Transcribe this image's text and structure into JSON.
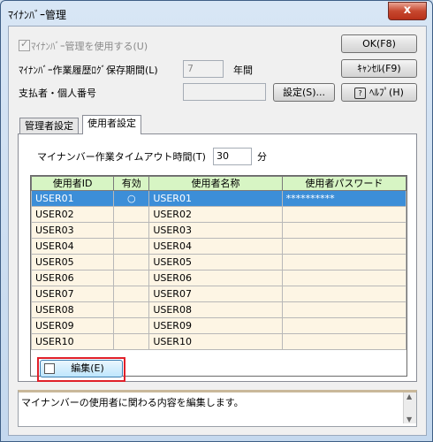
{
  "window": {
    "title": "ﾏｲﾅﾝﾊﾞｰ管理",
    "close": "x"
  },
  "settings": {
    "use_label": "ﾏｲﾅﾝﾊﾞｰ管理を使用する(U)",
    "use_checked": true,
    "retention_label": "ﾏｲﾅﾝﾊﾞｰ作業履歴ﾛｸﾞ保存期間(L)",
    "retention_value": "7",
    "retention_unit": "年間",
    "payer_label": "支払者・個人番号",
    "payer_value": ""
  },
  "buttons": {
    "ok": "OK(F8)",
    "cancel": "ｷｬﾝｾﾙ(F9)",
    "settings": "設定(S)...",
    "help": "ﾍﾙﾌﾟ(H)",
    "edit": "編集(E)"
  },
  "tabs": [
    {
      "label": "管理者設定",
      "active": false
    },
    {
      "label": "使用者設定",
      "active": true
    }
  ],
  "timeout": {
    "label": "マイナンバー作業タイムアウト時間(T)",
    "value": "30",
    "unit": "分"
  },
  "table": {
    "headers": [
      "使用者ID",
      "有効",
      "使用者名称",
      "使用者パスワード"
    ],
    "rows": [
      {
        "id": "USER01",
        "enabled": "○",
        "name": "USER01",
        "password": "**********"
      },
      {
        "id": "USER02",
        "enabled": "",
        "name": "USER02",
        "password": ""
      },
      {
        "id": "USER03",
        "enabled": "",
        "name": "USER03",
        "password": ""
      },
      {
        "id": "USER04",
        "enabled": "",
        "name": "USER04",
        "password": ""
      },
      {
        "id": "USER05",
        "enabled": "",
        "name": "USER05",
        "password": ""
      },
      {
        "id": "USER06",
        "enabled": "",
        "name": "USER06",
        "password": ""
      },
      {
        "id": "USER07",
        "enabled": "",
        "name": "USER07",
        "password": ""
      },
      {
        "id": "USER08",
        "enabled": "",
        "name": "USER08",
        "password": ""
      },
      {
        "id": "USER09",
        "enabled": "",
        "name": "USER09",
        "password": ""
      },
      {
        "id": "USER10",
        "enabled": "",
        "name": "USER10",
        "password": ""
      }
    ]
  },
  "status_text": "マイナンバーの使用者に関わる内容を編集します。"
}
